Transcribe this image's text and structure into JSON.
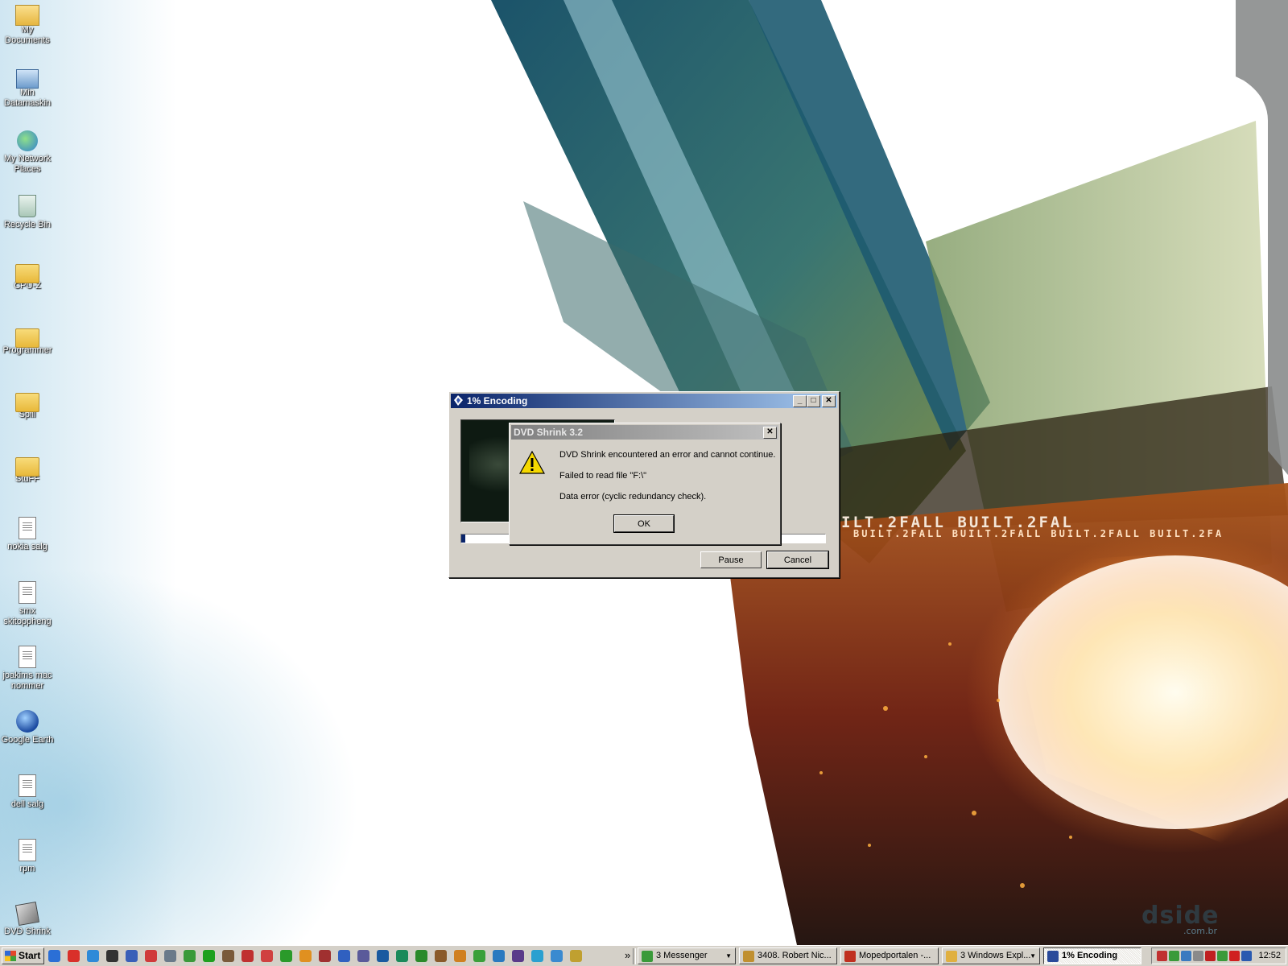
{
  "desktop": {
    "icons": [
      {
        "label": "My\nDocuments",
        "icon": "my-documents-icon"
      },
      {
        "label": "Min\nDatamaskin",
        "icon": "computer-icon"
      },
      {
        "label": "My Network\nPlaces",
        "icon": "network-places-icon"
      },
      {
        "label": "Recycle Bin",
        "icon": "recycle-bin-icon"
      },
      {
        "label": "CPU-Z",
        "icon": "folder-icon"
      },
      {
        "label": "Programmer",
        "icon": "folder-icon"
      },
      {
        "label": "Spill",
        "icon": "folder-icon"
      },
      {
        "label": "StuFF",
        "icon": "folder-icon"
      },
      {
        "label": "nokia salg",
        "icon": "text-file-icon"
      },
      {
        "label": "smx\nskitoppheng",
        "icon": "text-file-icon"
      },
      {
        "label": "joakims mac\nnommer",
        "icon": "text-file-icon"
      },
      {
        "label": "Google Earth",
        "icon": "google-earth-icon"
      },
      {
        "label": "dell salg",
        "icon": "text-file-icon"
      },
      {
        "label": "rpm",
        "icon": "text-file-icon"
      },
      {
        "label": "DVD Shrink",
        "icon": "dvd-shrink-icon"
      }
    ],
    "wallpaper_text": {
      "built_main": "ILT.2FALL BUILT.2FAL",
      "built_sub": "BUILT.2FALL BUILT.2FALL BUILT.2FALL BUILT.2FA",
      "brand": "dside",
      "brand_sub": ".com.br"
    }
  },
  "encoding_window": {
    "title": "1% Encoding",
    "minimize": "_",
    "maximize": "□",
    "close": "✕",
    "progress_percent": 1,
    "pause_label": "Pause",
    "cancel_label": "Cancel"
  },
  "error_dialog": {
    "title": "DVD Shrink 3.2",
    "close": "✕",
    "line1": "DVD Shrink encountered an error and cannot continue.",
    "line2": "Failed to read file \"F:\\\"",
    "line3": "Data error (cyclic redundancy check).",
    "ok_label": "OK",
    "icon": "warning-icon"
  },
  "taskbar": {
    "start_label": "Start",
    "overflow": "»",
    "quick_launch_colors": [
      "#2b6fd6",
      "#d9302a",
      "#2e8ad8",
      "#333333",
      "#3a5fb8",
      "#d03a3a",
      "#6a7a8a",
      "#3a9a3a",
      "#1ea01e",
      "#7a5a3a",
      "#c03030",
      "#d04040",
      "#2a9a2a",
      "#e09020",
      "#a03030",
      "#3060c0",
      "#5a5a9a",
      "#1a5aa0",
      "#1a8a5a",
      "#2a8a2a",
      "#8a5a2a",
      "#d08020",
      "#3aa03a",
      "#2a7ac0",
      "#5a3a8a",
      "#2aa0d0",
      "#3a8ad0",
      "#c0a030"
    ],
    "tasks": [
      {
        "label": "3 Messenger",
        "color": "#3a9a3a",
        "group": true
      },
      {
        "label": "3408. Robert Nic...",
        "color": "#c09030",
        "group": false
      },
      {
        "label": "Mopedportalen -...",
        "color": "#c03020",
        "group": false
      },
      {
        "label": "3 Windows Expl...",
        "color": "#e0b040",
        "group": true
      },
      {
        "label": "1% Encoding",
        "color": "#2a4a9a",
        "group": false
      }
    ],
    "clock": "12:52",
    "tray_colors": [
      "#c03030",
      "#3a9a3a",
      "#3a7ac0",
      "#8a8a8a",
      "#c02020",
      "#3a9a3a",
      "#d02020",
      "#2a5ab0"
    ]
  }
}
